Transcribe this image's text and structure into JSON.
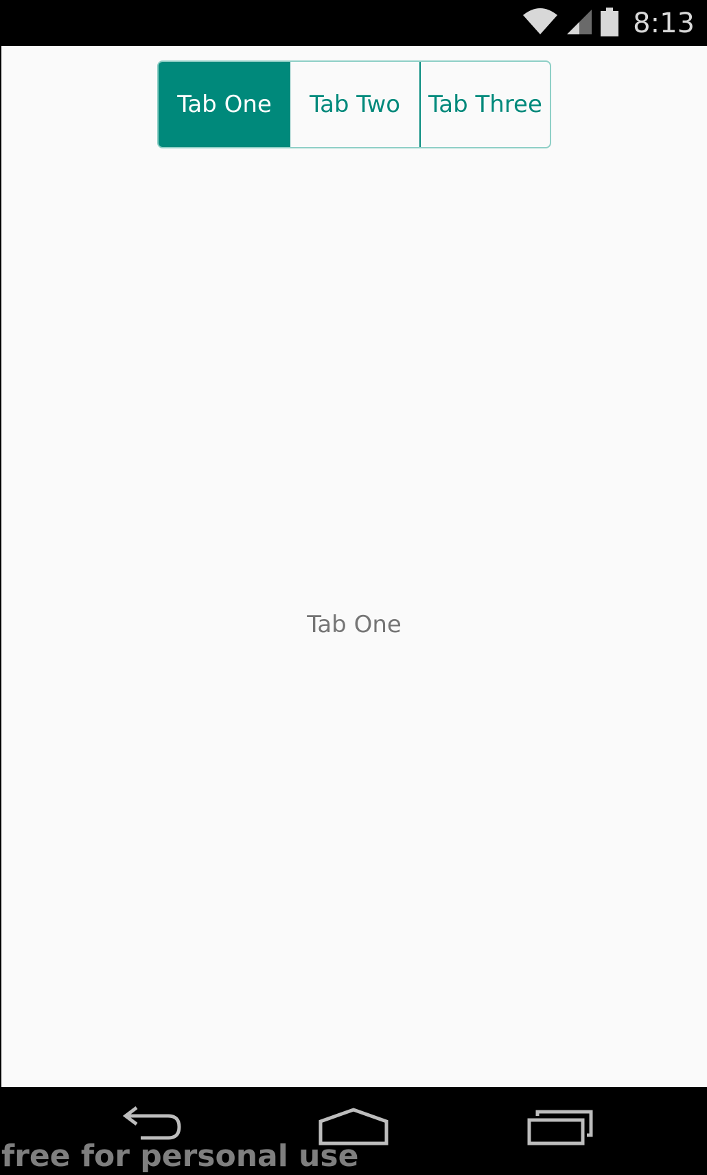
{
  "status_bar": {
    "time": "8:13",
    "icons": [
      "wifi-icon",
      "cell-signal-icon",
      "battery-icon"
    ]
  },
  "tabs": [
    {
      "label": "Tab One",
      "selected": true
    },
    {
      "label": "Tab Two",
      "selected": false
    },
    {
      "label": "Tab Three",
      "selected": false
    }
  ],
  "content": {
    "label": "Tab One"
  },
  "nav_bar": {
    "icons": [
      "back-icon",
      "home-icon",
      "recents-icon"
    ]
  },
  "watermark": "free for personal use",
  "colors": {
    "accent": "#00897b",
    "background": "#fafafa",
    "content_text": "#757575"
  }
}
